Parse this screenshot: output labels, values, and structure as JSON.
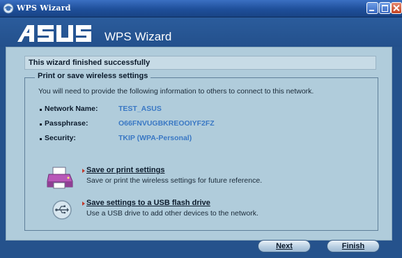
{
  "window": {
    "title": "WPS Wizard",
    "controls": [
      "minimize",
      "maximize",
      "close"
    ]
  },
  "header": {
    "brand": "ASUS",
    "title": "WPS Wizard"
  },
  "status": {
    "message": "This wizard finished successfully"
  },
  "settings_group": {
    "title": "Print or save wireless settings",
    "instruction": "You will need to provide the following information to others to connect to this network.",
    "rows": [
      {
        "label": "Network Name:",
        "value": "TEST_ASUS"
      },
      {
        "label": "Passphrase:",
        "value": "O66FNVUGBKREOOIYF2FZ"
      },
      {
        "label": "Security:",
        "value": "TKIP (WPA-Personal)"
      }
    ]
  },
  "actions": [
    {
      "icon": "printer-icon",
      "label": "Save or print settings",
      "description": "Save or print the wireless settings for future reference."
    },
    {
      "icon": "usb-icon",
      "label": "Save settings to a USB flash drive",
      "description": "Use a USB drive to add other devices to the network."
    }
  ],
  "buttons": {
    "next": "Next",
    "finish": "Finish"
  },
  "colors": {
    "title_bar": "#1f4f9a",
    "content_bg": "#b0ccdb",
    "value_text": "#3a78c4"
  }
}
